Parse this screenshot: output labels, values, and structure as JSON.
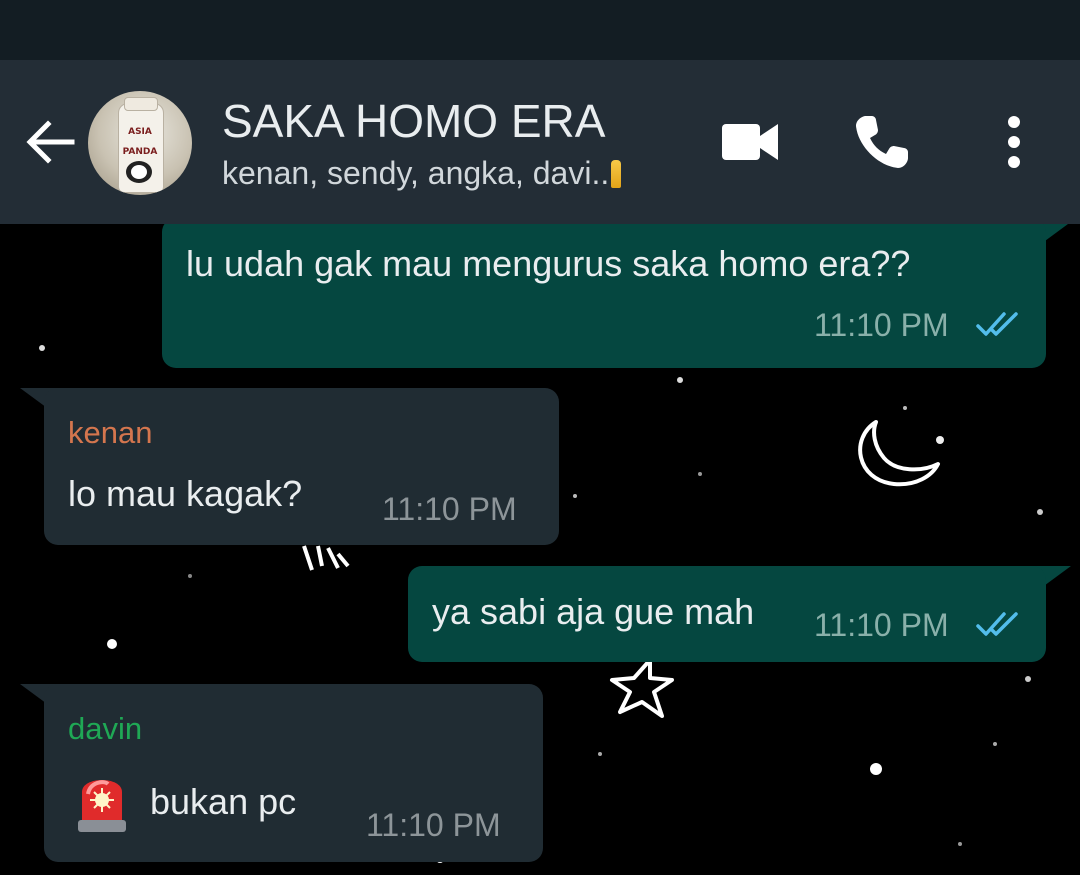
{
  "header": {
    "title": "SAKA HOMO ERA",
    "subtitle": "kenan, sendy, angka, davi.."
  },
  "messages": [
    {
      "direction": "outgoing",
      "text": "lu udah gak mau mengurus saka homo era??",
      "time": "11:10 PM",
      "status": "read"
    },
    {
      "direction": "incoming",
      "sender": "kenan",
      "sender_color": "#d4764e",
      "text": "lo mau kagak?",
      "time": "11:10 PM"
    },
    {
      "direction": "outgoing",
      "text": "ya sabi aja gue mah",
      "time": "11:10 PM",
      "status": "read"
    },
    {
      "direction": "incoming",
      "sender": "davin",
      "sender_color": "#1fa855",
      "emoji": "police-light-emoji",
      "text": "bukan pc",
      "time": "11:10 PM"
    }
  ],
  "icons": {
    "back": "arrow-back-icon",
    "video": "video-camera-icon",
    "call": "phone-icon",
    "menu": "more-vertical-icon",
    "read_status": "double-check-icon"
  },
  "colors": {
    "app_bar": "#232d36",
    "status_bar": "#131d23",
    "outgoing_bubble": "#054740",
    "incoming_bubble": "#202c33",
    "read_ticks": "#53bdeb",
    "wallpaper": "#000000"
  }
}
